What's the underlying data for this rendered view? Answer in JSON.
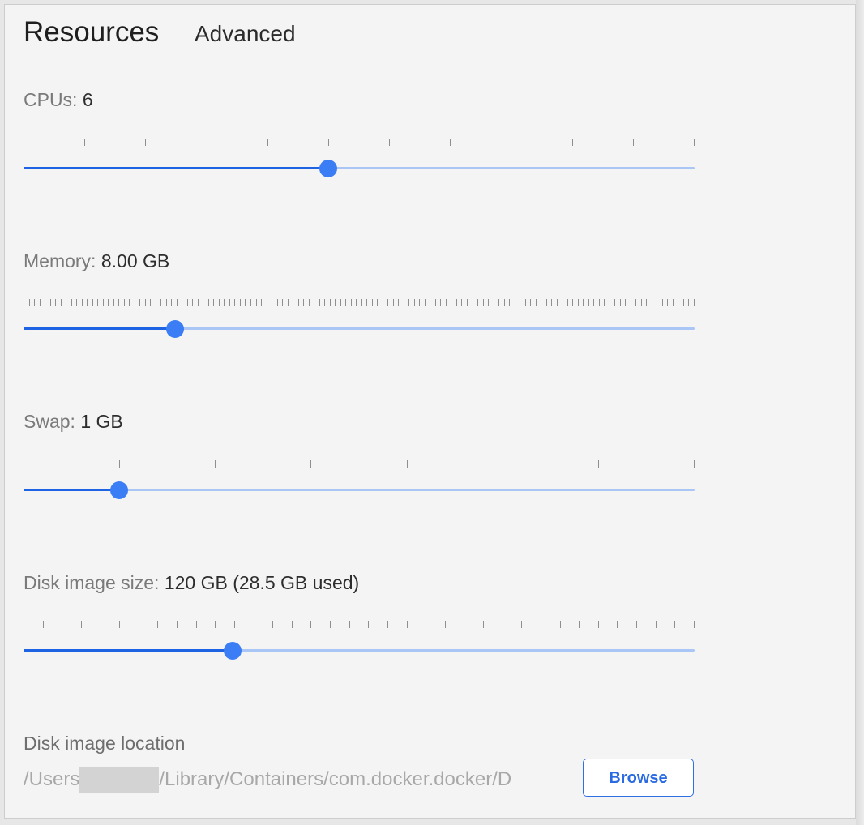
{
  "header": {
    "title": "Resources",
    "subtitle": "Advanced"
  },
  "settings": {
    "cpus": {
      "label": "CPUs:",
      "value": "6",
      "level": 0.4545,
      "ticks": 12
    },
    "memory": {
      "label": "Memory:",
      "value": "8.00 GB",
      "level": 0.226,
      "ticks": 128
    },
    "swap": {
      "label": "Swap:",
      "value": "1 GB",
      "level": 0.1429,
      "ticks": 8
    },
    "disk_size": {
      "label": "Disk image size:",
      "value": "120 GB (28.5 GB used)",
      "level": 0.3116,
      "ticks": 36
    }
  },
  "disk_location": {
    "label": "Disk image location",
    "path_prefix": "/Users",
    "path_suffix": "/Library/Containers/com.docker.docker/D",
    "browse_label": "Browse"
  },
  "colors": {
    "accent": "#3b7df5",
    "track_fill": "#1e63e4",
    "track_rest": "#a9c6f7"
  }
}
